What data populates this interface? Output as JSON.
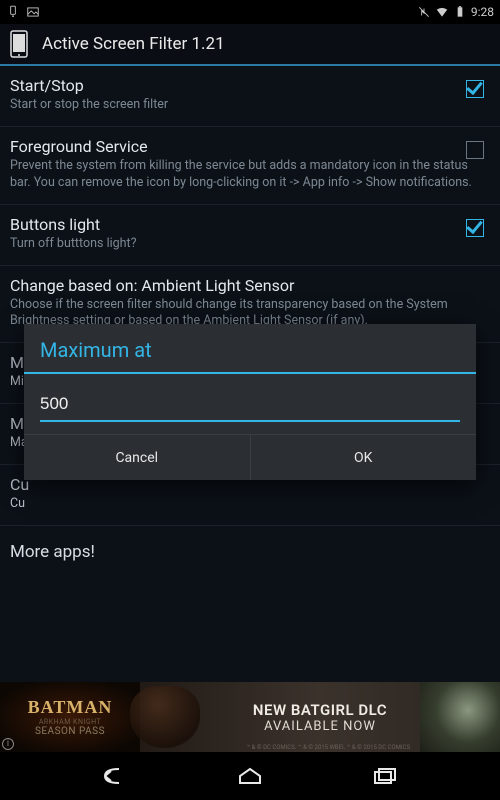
{
  "statusbar": {
    "time": "9:28"
  },
  "header": {
    "title": "Active Screen Filter 1.21"
  },
  "settings": [
    {
      "title": "Start/Stop",
      "sub": "Start or stop the screen filter",
      "checked": true,
      "hasCheck": true
    },
    {
      "title": "Foreground Service",
      "sub": "Prevent the system from killing the service but adds a mandatory icon in the status bar. You can remove the icon by long-clicking on it -> App info -> Show notifications.",
      "checked": false,
      "hasCheck": true
    },
    {
      "title": "Buttons light",
      "sub": "Turn off butttons light?",
      "checked": true,
      "hasCheck": true
    },
    {
      "title": "Change based on: Ambient Light Sensor",
      "sub": "Choose if the screen filter should change its transparency based on the System Brightness setting or based on the Ambient Light Sensor (if any).",
      "hasCheck": false
    }
  ],
  "obscured": [
    {
      "titleFrag": "M",
      "subFrag": "Mi"
    },
    {
      "titleFrag": "M",
      "subFrag": "Ma"
    },
    {
      "titleFrag": "Cu",
      "subFrag": "Cu"
    }
  ],
  "moreapps": "More apps!",
  "dialog": {
    "title": "Maximum at",
    "value": "500",
    "cancel": "Cancel",
    "ok": "OK"
  },
  "ad": {
    "brand": "BATMAN",
    "brandSub": "ARKHAM KNIGHT",
    "brandSub2": "SEASON PASS",
    "line1": "NEW BATGIRL DLC",
    "line2": "AVAILABLE NOW",
    "fine": "™ & © DC COMICS. ™ & © 2015 WBEI. ™ & © 2015 DC COMICS"
  }
}
